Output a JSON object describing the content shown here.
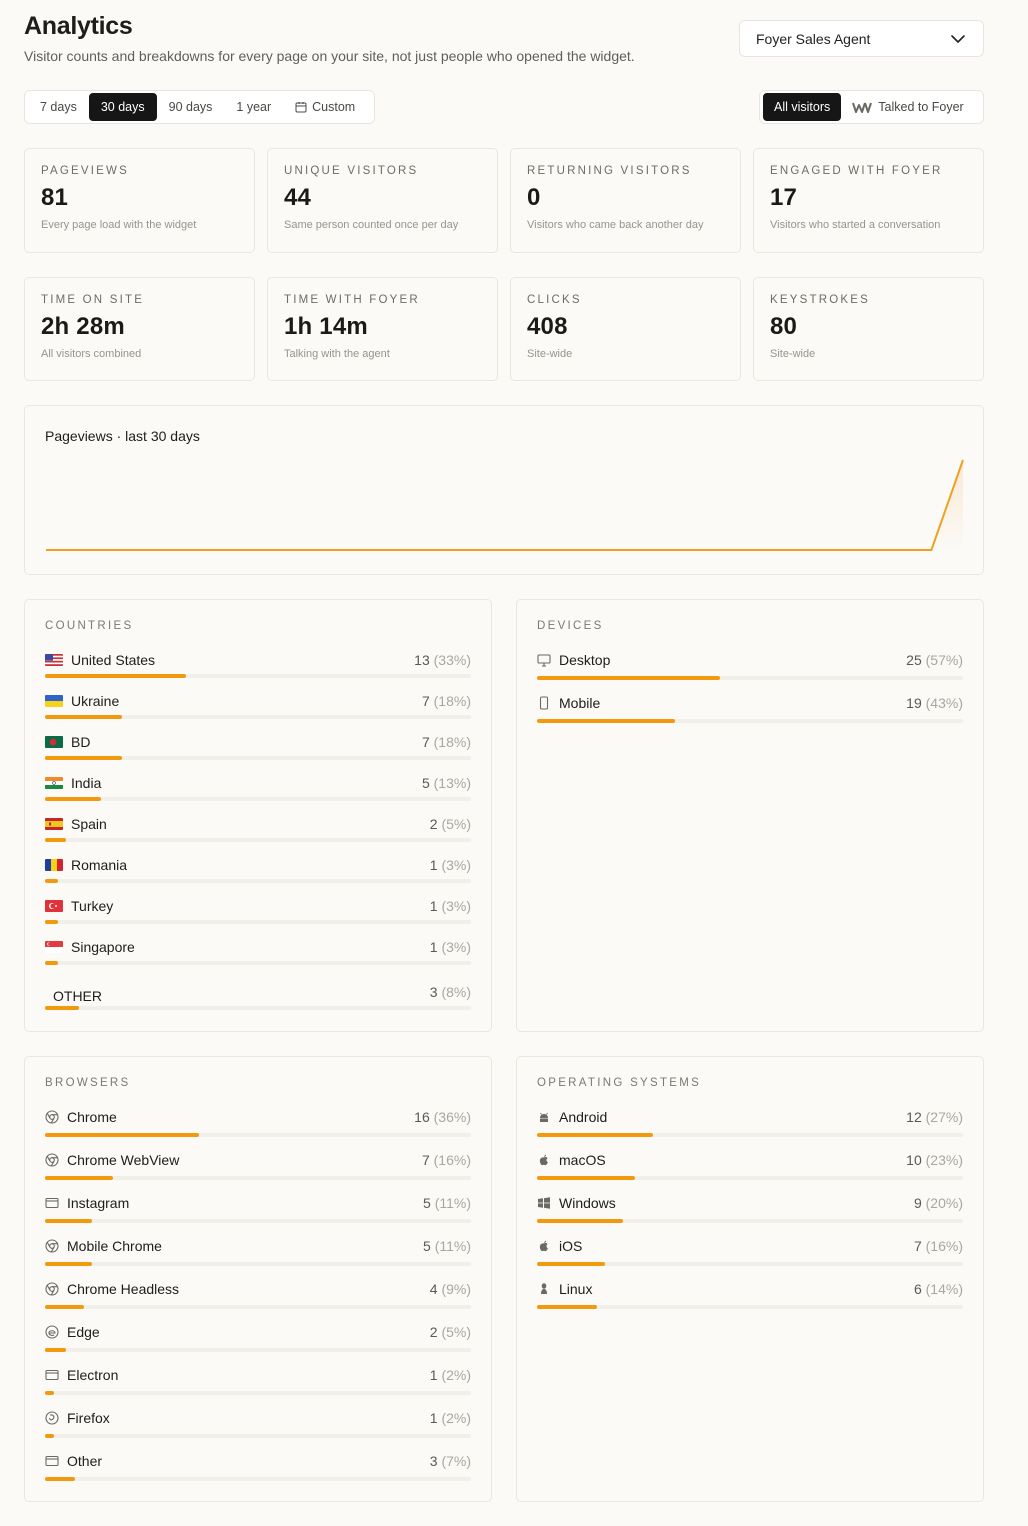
{
  "header": {
    "title": "Analytics",
    "subtitle": "Visitor counts and breakdowns for every page on your site, not just people who opened the widget.",
    "agent": "Foyer Sales Agent"
  },
  "ranges": [
    "7 days",
    "30 days",
    "90 days",
    "1 year",
    "Custom"
  ],
  "active_range": "30 days",
  "filters": [
    "All visitors",
    "Talked to Foyer"
  ],
  "active_filter": "All visitors",
  "stats": [
    {
      "label": "PAGEVIEWS",
      "value": "81",
      "caption": "Every page load with the widget"
    },
    {
      "label": "UNIQUE VISITORS",
      "value": "44",
      "caption": "Same person counted once per day"
    },
    {
      "label": "RETURNING VISITORS",
      "value": "0",
      "caption": "Visitors who came back another day"
    },
    {
      "label": "ENGAGED WITH FOYER",
      "value": "17",
      "caption": "Visitors who started a conversation"
    },
    {
      "label": "TIME ON SITE",
      "value": "2h 28m",
      "caption": "All visitors combined"
    },
    {
      "label": "TIME WITH FOYER",
      "value": "1h 14m",
      "caption": "Talking with the agent"
    },
    {
      "label": "CLICKS",
      "value": "408",
      "caption": "Site-wide"
    },
    {
      "label": "KEYSTROKES",
      "value": "80",
      "caption": "Site-wide"
    }
  ],
  "chart_data": {
    "type": "line",
    "title": "Pageviews · last 30 days",
    "values": [
      0,
      0,
      0,
      0,
      0,
      0,
      0,
      0,
      0,
      0,
      0,
      0,
      0,
      0,
      0,
      0,
      0,
      0,
      0,
      0,
      0,
      0,
      0,
      0,
      0,
      0,
      0,
      0,
      0,
      81
    ],
    "color": "#f0a020"
  },
  "countries": {
    "title": "COUNTRIES",
    "items": [
      {
        "flag": "us",
        "name": "United States",
        "count": "13",
        "pct": "(33%)",
        "share": 0.33
      },
      {
        "flag": "ua",
        "name": "Ukraine",
        "count": "7",
        "pct": "(18%)",
        "share": 0.18
      },
      {
        "flag": "bd",
        "name": "BD",
        "count": "7",
        "pct": "(18%)",
        "share": 0.18
      },
      {
        "flag": "in",
        "name": "India",
        "count": "5",
        "pct": "(13%)",
        "share": 0.13
      },
      {
        "flag": "es",
        "name": "Spain",
        "count": "2",
        "pct": "(5%)",
        "share": 0.05
      },
      {
        "flag": "ro",
        "name": "Romania",
        "count": "1",
        "pct": "(3%)",
        "share": 0.03
      },
      {
        "flag": "tr",
        "name": "Turkey",
        "count": "1",
        "pct": "(3%)",
        "share": 0.03
      },
      {
        "flag": "sg",
        "name": "Singapore",
        "count": "1",
        "pct": "(3%)",
        "share": 0.03
      },
      {
        "flag": "",
        "name": "OTHER",
        "count": "3",
        "pct": "(8%)",
        "share": 0.08
      }
    ]
  },
  "devices": {
    "title": "DEVICES",
    "items": [
      {
        "icon": "desktop-icon",
        "name": "Desktop",
        "count": "25",
        "pct": "(57%)",
        "share": 0.57
      },
      {
        "icon": "mobile-icon",
        "name": "Mobile",
        "count": "19",
        "pct": "(43%)",
        "share": 0.43
      }
    ]
  },
  "browsers": {
    "title": "BROWSERS",
    "items": [
      {
        "icon": "chrome-icon",
        "name": "Chrome",
        "count": "16",
        "pct": "(36%)",
        "share": 0.36
      },
      {
        "icon": "chrome-icon",
        "name": "Chrome WebView",
        "count": "7",
        "pct": "(16%)",
        "share": 0.16
      },
      {
        "icon": "window-icon",
        "name": "Instagram",
        "count": "5",
        "pct": "(11%)",
        "share": 0.11
      },
      {
        "icon": "chrome-icon",
        "name": "Mobile Chrome",
        "count": "5",
        "pct": "(11%)",
        "share": 0.11
      },
      {
        "icon": "chrome-icon",
        "name": "Chrome Headless",
        "count": "4",
        "pct": "(9%)",
        "share": 0.09
      },
      {
        "icon": "edge-icon",
        "name": "Edge",
        "count": "2",
        "pct": "(5%)",
        "share": 0.05
      },
      {
        "icon": "window-icon",
        "name": "Electron",
        "count": "1",
        "pct": "(2%)",
        "share": 0.02
      },
      {
        "icon": "firefox-icon",
        "name": "Firefox",
        "count": "1",
        "pct": "(2%)",
        "share": 0.02
      },
      {
        "icon": "window-icon",
        "name": "Other",
        "count": "3",
        "pct": "(7%)",
        "share": 0.07
      }
    ]
  },
  "os": {
    "title": "OPERATING SYSTEMS",
    "items": [
      {
        "icon": "android-icon",
        "name": "Android",
        "count": "12",
        "pct": "(27%)",
        "share": 0.27
      },
      {
        "icon": "apple-icon",
        "name": "macOS",
        "count": "10",
        "pct": "(23%)",
        "share": 0.23
      },
      {
        "icon": "windows-icon",
        "name": "Windows",
        "count": "9",
        "pct": "(20%)",
        "share": 0.2
      },
      {
        "icon": "apple-icon",
        "name": "iOS",
        "count": "7",
        "pct": "(16%)",
        "share": 0.16
      },
      {
        "icon": "linux-icon",
        "name": "Linux",
        "count": "6",
        "pct": "(14%)",
        "share": 0.14
      }
    ]
  }
}
